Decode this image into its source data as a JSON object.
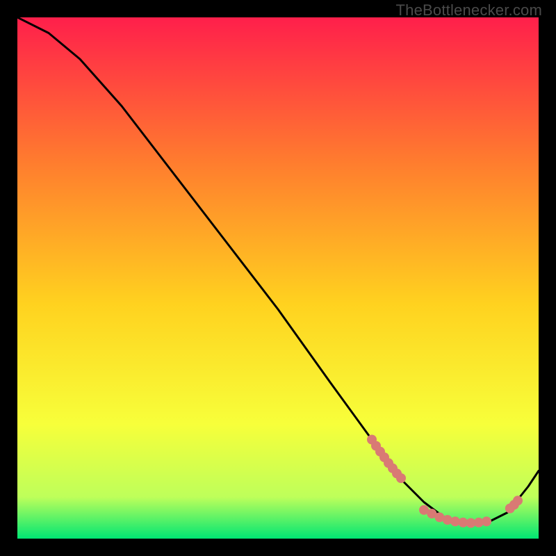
{
  "attribution": "TheBottlenecker.com",
  "colors": {
    "gradient_top": "#ff1f4b",
    "gradient_mid_upper": "#ff7d2e",
    "gradient_mid": "#ffd21f",
    "gradient_mid_lower": "#f7ff3a",
    "gradient_lower": "#beff5a",
    "gradient_bottom": "#00e673",
    "curve": "#000000",
    "markers": "#d97a74",
    "frame": "#000000"
  },
  "chart_data": {
    "type": "line",
    "title": "",
    "xlabel": "",
    "ylabel": "",
    "xlim": [
      0,
      100
    ],
    "ylim": [
      0,
      100
    ],
    "series": [
      {
        "name": "curve",
        "x": [
          0,
          6,
          12,
          20,
          30,
          40,
          50,
          60,
          68,
          74,
          78,
          82,
          86,
          90,
          94,
          98,
          100
        ],
        "y": [
          100,
          97,
          92,
          83,
          70,
          57,
          44,
          30,
          19,
          11,
          7,
          4,
          3,
          3,
          5,
          10,
          13
        ]
      },
      {
        "name": "marker-cluster-left",
        "x": [
          68.0,
          68.8,
          69.6,
          70.4,
          71.2,
          72.0,
          72.8,
          73.6
        ],
        "y": [
          19.0,
          17.8,
          16.7,
          15.6,
          14.5,
          13.5,
          12.5,
          11.6
        ]
      },
      {
        "name": "marker-cluster-bottom",
        "x": [
          78,
          79.5,
          81,
          82.5,
          84,
          85.5,
          87,
          88.5,
          90
        ],
        "y": [
          5.5,
          4.8,
          4.1,
          3.6,
          3.3,
          3.1,
          3.0,
          3.1,
          3.3
        ]
      },
      {
        "name": "marker-cluster-right",
        "x": [
          94.5,
          95.3,
          96.0
        ],
        "y": [
          5.8,
          6.5,
          7.3
        ]
      }
    ]
  }
}
